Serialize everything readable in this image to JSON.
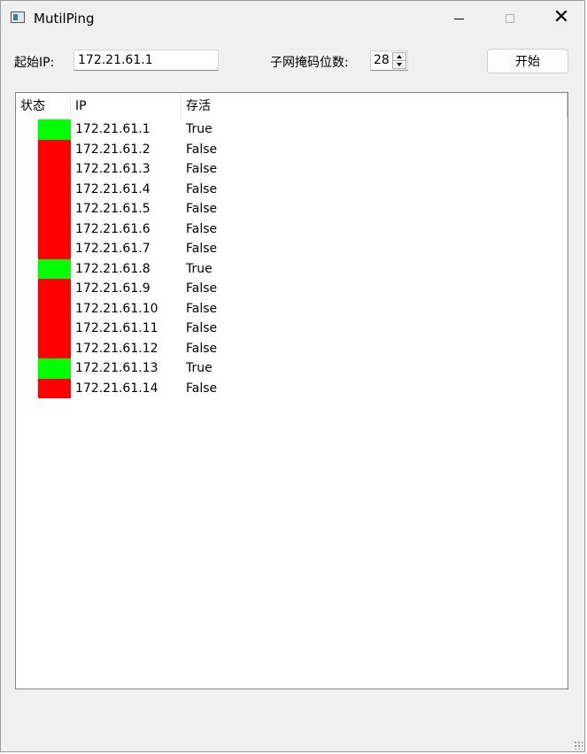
{
  "window": {
    "title": "MutilPing"
  },
  "form": {
    "start_ip_label": "起始IP:",
    "start_ip_value": "172.21.61.1",
    "mask_label": "子网掩码位数:",
    "mask_value": "28",
    "start_button": "开始"
  },
  "table": {
    "headers": [
      "状态",
      "IP",
      "存活"
    ],
    "rows": [
      {
        "ip": "172.21.61.1",
        "alive": "True"
      },
      {
        "ip": "172.21.61.2",
        "alive": "False"
      },
      {
        "ip": "172.21.61.3",
        "alive": "False"
      },
      {
        "ip": "172.21.61.4",
        "alive": "False"
      },
      {
        "ip": "172.21.61.5",
        "alive": "False"
      },
      {
        "ip": "172.21.61.6",
        "alive": "False"
      },
      {
        "ip": "172.21.61.7",
        "alive": "False"
      },
      {
        "ip": "172.21.61.8",
        "alive": "True"
      },
      {
        "ip": "172.21.61.9",
        "alive": "False"
      },
      {
        "ip": "172.21.61.10",
        "alive": "False"
      },
      {
        "ip": "172.21.61.11",
        "alive": "False"
      },
      {
        "ip": "172.21.61.12",
        "alive": "False"
      },
      {
        "ip": "172.21.61.13",
        "alive": "True"
      },
      {
        "ip": "172.21.61.14",
        "alive": "False"
      }
    ]
  },
  "colors": {
    "alive": "#00ff00",
    "dead": "#ff0000"
  },
  "icons": {
    "app": "window-app-icon",
    "minimize": "minimize-icon",
    "maximize": "maximize-icon",
    "close": "close-icon",
    "spin_up": "chevron-up-icon",
    "spin_down": "chevron-down-icon",
    "resize": "resize-grip-icon"
  }
}
